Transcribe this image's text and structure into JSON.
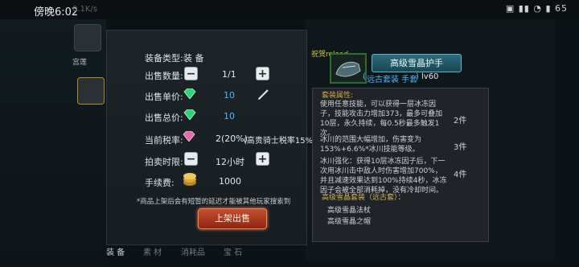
{
  "status": {
    "time": "傍晚6:02",
    "speed": "0.1K/s",
    "right": "▣ ▮▮ ◔ ▮ 65"
  },
  "left": {
    "label": "宫莲"
  },
  "sell": {
    "equip_type_label": "装备类型:",
    "equip_type_value": "装 备",
    "qty_label": "出售数量:",
    "qty_value": "1/1",
    "unit_price_label": "出售单价:",
    "unit_price_value": "10",
    "total_price_label": "出售总价:",
    "total_price_value": "10",
    "tax_label": "当前税率:",
    "tax_value": "2(20%)",
    "tax_note": "(高贵骑士税率15%)",
    "duration_label": "拍卖时限:",
    "duration_value": "12小时",
    "fee_label": "手续费:",
    "fee_value": "1000",
    "note": "*商品上架后会有短暂的延迟才能被其他玩家搜索到",
    "list_button": "上架出售"
  },
  "item": {
    "congrats": "祝贺reload...",
    "name": "高级雪晶护手",
    "set_line": "远古套装 手套",
    "level": "lv60",
    "section_title": "套装属性:",
    "desc_1": "使用任意技能，可以获得一层冰冻因子，技能攻击力增加373，最多可叠加10层，永久持续，每0.5秒最多触发1次。",
    "count_1": "2件",
    "desc_2": "冰川的范围大幅增加，伤害变为153%+6.6%*冰川技能等级。",
    "count_2": "3件",
    "desc_3": "冰川强化：获得10层冰冻因子后，下一次用冰川击中敌人时伤害增加700%，并且减速效果达到100%持续4秒，冰冻因子会被全部消耗掉，没有冷却时间。",
    "count_3": "4件",
    "set_title": "高级雪晶套装（远古套）：",
    "set_item_1": "高级雪晶法杖",
    "set_item_2": "高级雪晶之帽"
  },
  "tabs": [
    "装 备",
    "素 材",
    "消耗品",
    "宝 石"
  ],
  "colors": {
    "accent_blue": "#4fb6ff",
    "button_red": "#a83a20",
    "item_green": "#2b6b34"
  }
}
